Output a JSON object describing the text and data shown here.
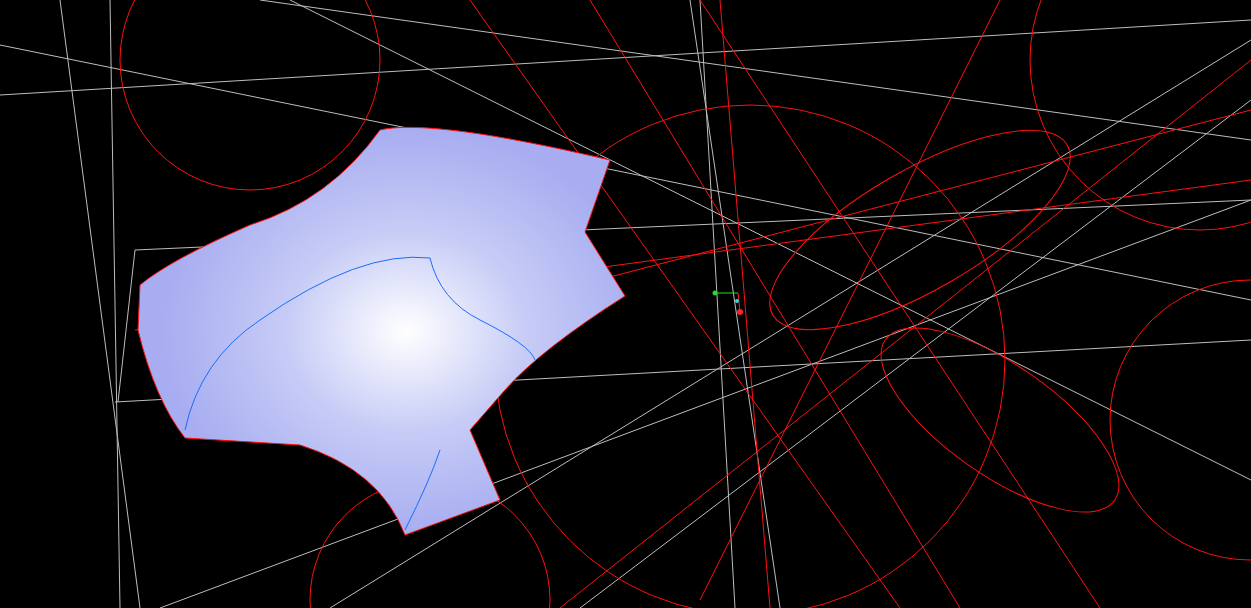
{
  "viewport": {
    "kind": "surface-model"
  }
}
